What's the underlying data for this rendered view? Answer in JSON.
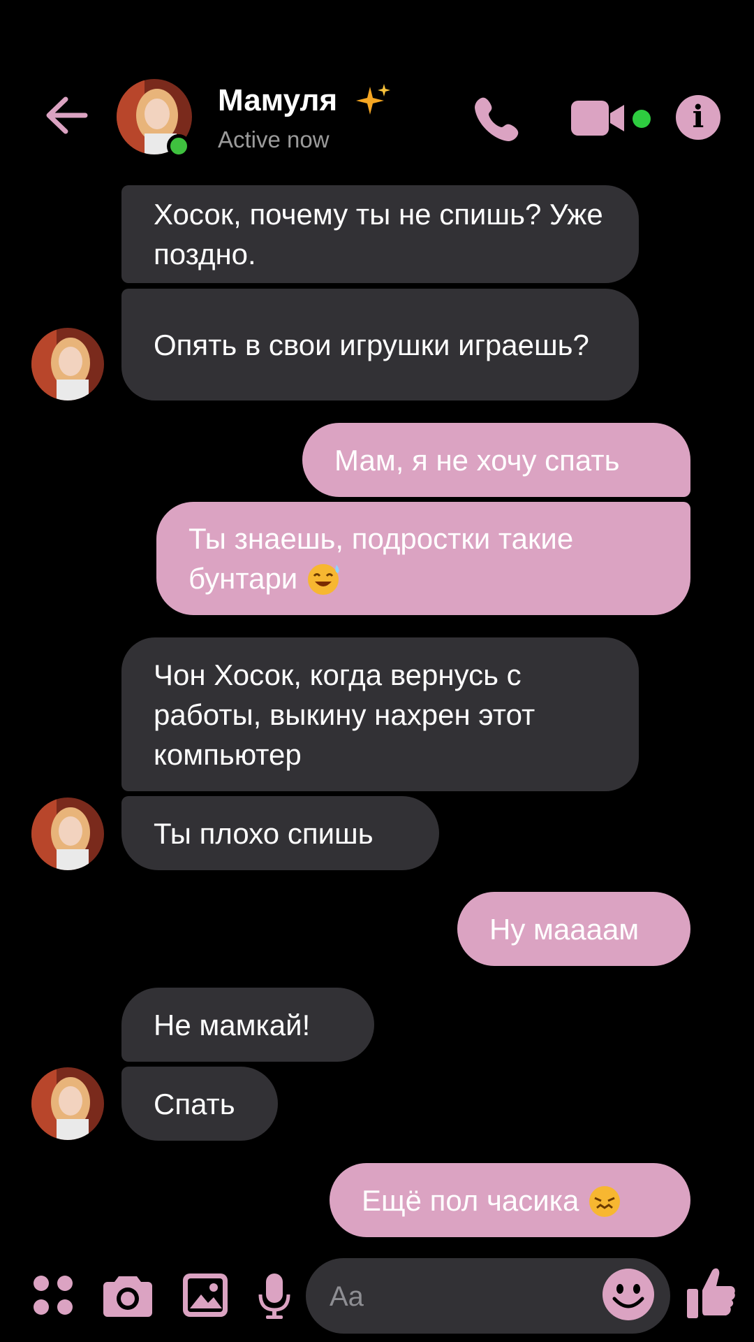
{
  "header": {
    "contact_name": "Мамуля",
    "status": "Active now"
  },
  "messages": [
    {
      "side": "in",
      "text": "Хосок, почему ты не спишь? Уже поздно."
    },
    {
      "side": "in",
      "text": "Опять в свои игрушки играешь?"
    },
    {
      "side": "out",
      "text": "Мам, я не хочу спать"
    },
    {
      "side": "out",
      "text": "Ты знаешь, подростки такие бунтари",
      "emoji": "sweat-smile"
    },
    {
      "side": "in",
      "text": "Чон Хосок, когда вернусь с работы, выкину нахрен этот компьютер"
    },
    {
      "side": "in",
      "text": "Ты плохо спишь"
    },
    {
      "side": "out",
      "text": "Ну мааaам"
    },
    {
      "side": "in",
      "text": "Не мамкай!"
    },
    {
      "side": "in",
      "text": "Спать"
    },
    {
      "side": "out",
      "text": "Ещё пол часика",
      "emoji": "confounded"
    }
  ],
  "composer": {
    "placeholder": "Aa"
  },
  "colors": {
    "accent": "#dba3c2",
    "incoming_bubble": "#323135",
    "background": "#000000",
    "online": "#3fc13f"
  },
  "icons": [
    "back-arrow-icon",
    "sparkle-icon",
    "phone-icon",
    "video-camera-icon",
    "info-icon",
    "apps-grid-icon",
    "camera-icon",
    "gallery-icon",
    "microphone-icon",
    "emoji-icon",
    "thumbs-up-icon"
  ]
}
